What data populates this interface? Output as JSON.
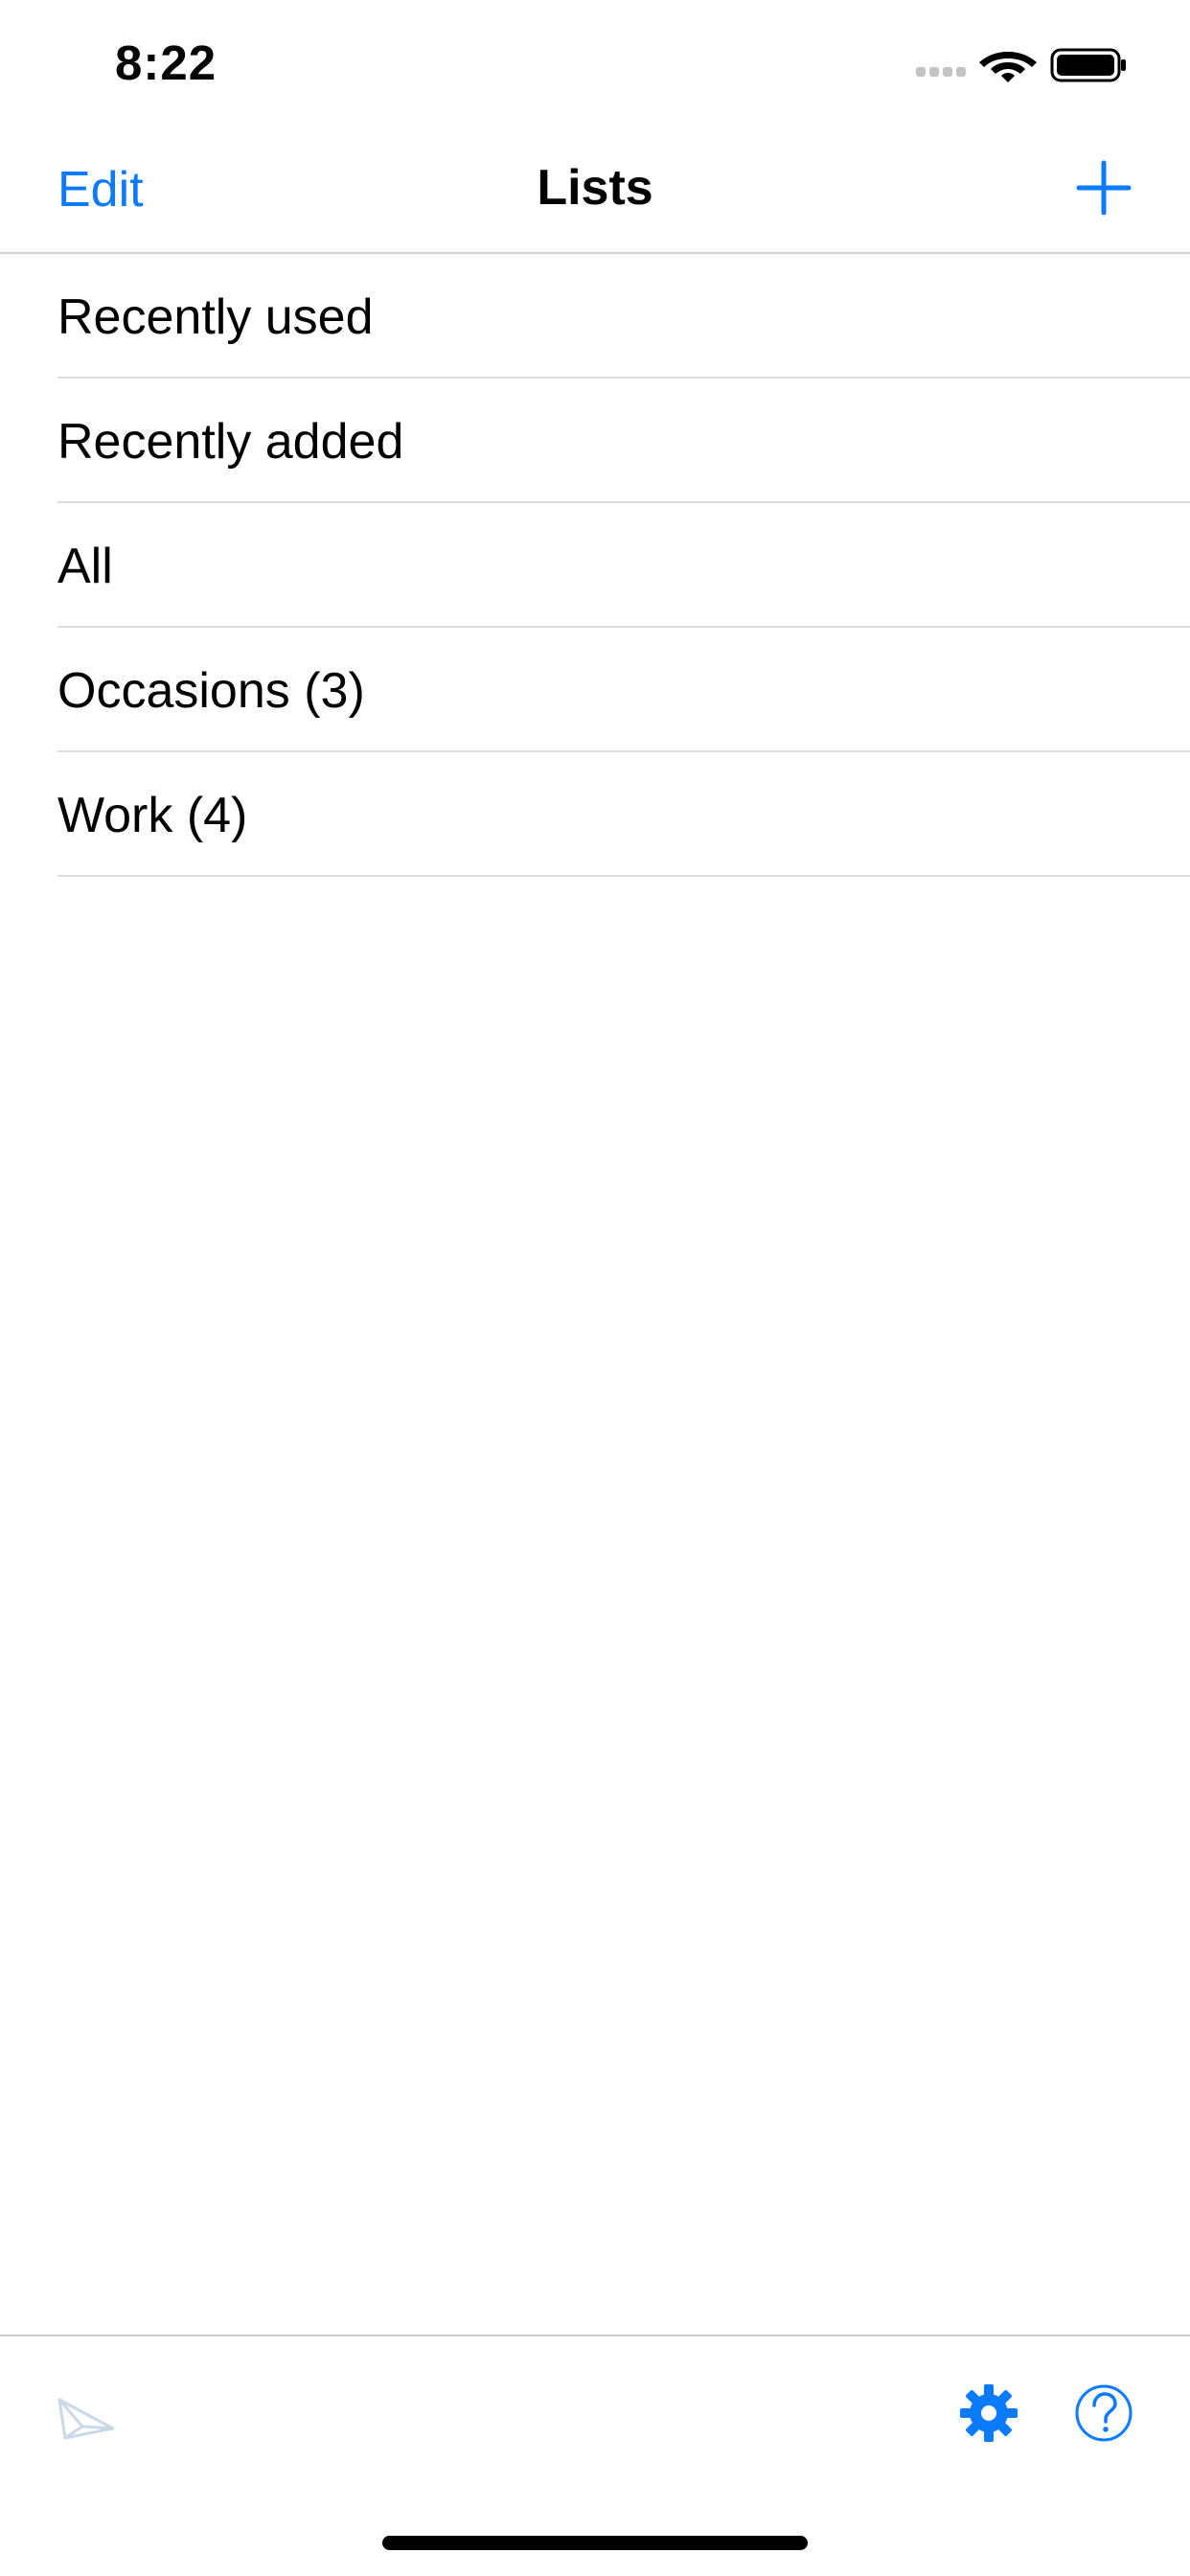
{
  "status_bar": {
    "time": "8:22"
  },
  "nav": {
    "edit_label": "Edit",
    "title": "Lists",
    "add_icon": "plus-icon"
  },
  "lists": [
    {
      "label": "Recently used"
    },
    {
      "label": "Recently added"
    },
    {
      "label": "All"
    },
    {
      "label": "Occasions (3)"
    },
    {
      "label": "Work (4)"
    }
  ],
  "toolbar": {
    "left_icon": "envelope-icon",
    "settings_icon": "gear-icon",
    "help_icon": "question-icon"
  },
  "colors": {
    "accent": "#0a7aff",
    "separator": "#dcdcdf",
    "disabled_icon": "#c9d9ea"
  }
}
